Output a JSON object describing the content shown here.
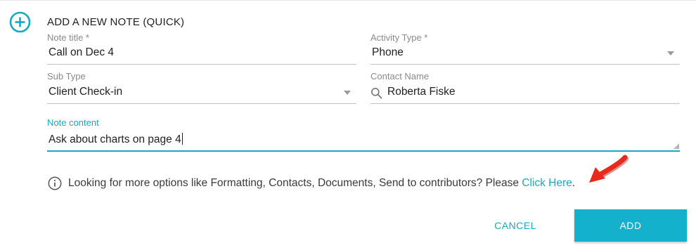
{
  "form": {
    "title": "ADD A NEW NOTE (QUICK)",
    "accent_color": "#17a9c0",
    "icon": "add-circle-icon"
  },
  "fields": {
    "note_title": {
      "label": "Note title *",
      "value": "Call on Dec 4"
    },
    "activity_type": {
      "label": "Activity Type *",
      "value": "Phone",
      "icon": "dropdown-caret-icon"
    },
    "sub_type": {
      "label": "Sub Type",
      "value": "Client Check-in",
      "icon": "dropdown-caret-icon"
    },
    "contact_name": {
      "label": "Contact Name",
      "value": "Roberta Fiske",
      "icon": "search-icon"
    },
    "note_content": {
      "label": "Note content",
      "value": "Ask about charts on page 4"
    }
  },
  "info": {
    "icon": "info-icon",
    "text": "Looking for more options like Formatting, Contacts, Documents, Send to contributors? Please ",
    "link_text": "Click Here",
    "suffix": "."
  },
  "annotation": {
    "icon": "red-arrow-icon",
    "color": "#e8291c"
  },
  "actions": {
    "cancel_label": "CANCEL",
    "add_label": "ADD",
    "add_color": "#14b1cd"
  }
}
